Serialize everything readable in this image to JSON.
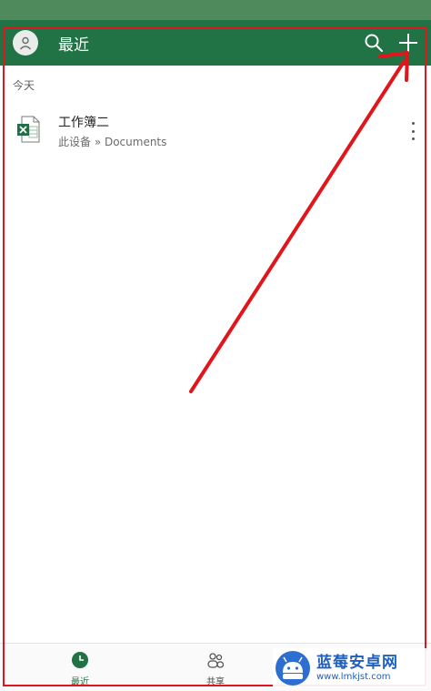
{
  "header": {
    "title": "最近",
    "avatar_icon": "user-avatar-icon",
    "search_icon": "search-icon",
    "add_icon": "plus-icon",
    "bg_color": "#217346"
  },
  "section": {
    "label": "今天"
  },
  "files": [
    {
      "name": "工作簿二",
      "path": "此设备 » Documents",
      "icon": "excel-file-icon"
    }
  ],
  "bottom_nav": {
    "items": [
      {
        "label": "最近",
        "icon": "clock-icon",
        "active": true
      },
      {
        "label": "共享",
        "icon": "people-icon",
        "active": false
      }
    ]
  },
  "annotation": {
    "color": "#e0161c"
  },
  "watermark": {
    "title": "蓝莓安卓网",
    "url": "www.lmkjst.com"
  }
}
